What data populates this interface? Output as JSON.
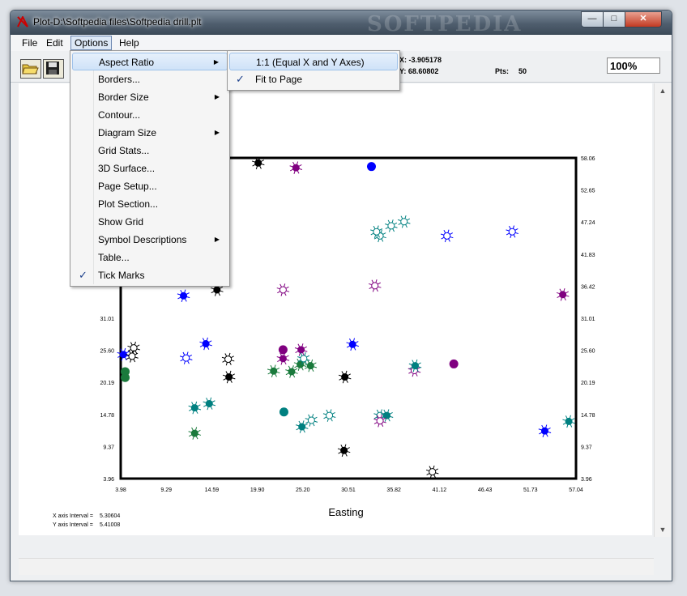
{
  "window": {
    "title": "Plot-D:\\Softpedia files\\Softpedia drill.plt",
    "watermark": "SOFTPEDIA"
  },
  "caption_buttons": {
    "minimize": "—",
    "maximize": "□",
    "close": "✕"
  },
  "menubar": {
    "file": "File",
    "edit": "Edit",
    "options": "Options",
    "help": "Help"
  },
  "toolbar": {
    "x_readout": "X: -3.905178",
    "y_readout": "Y: 68.60802",
    "pts_label": "Pts:",
    "pts_value": "50",
    "zoom": "100%"
  },
  "options_menu": [
    {
      "label": "Aspect Ratio",
      "submenu": true,
      "checked": false
    },
    {
      "label": "Borders...",
      "submenu": false,
      "checked": false
    },
    {
      "label": "Border Size",
      "submenu": true,
      "checked": false
    },
    {
      "label": "Contour...",
      "submenu": false,
      "checked": false
    },
    {
      "label": "Diagram Size",
      "submenu": true,
      "checked": false
    },
    {
      "label": "Grid Stats...",
      "submenu": false,
      "checked": false
    },
    {
      "label": "3D Surface...",
      "submenu": false,
      "checked": false
    },
    {
      "label": "Page Setup...",
      "submenu": false,
      "checked": false
    },
    {
      "label": "Plot Section...",
      "submenu": false,
      "checked": false
    },
    {
      "label": "Show Grid",
      "submenu": false,
      "checked": false
    },
    {
      "label": "Symbol Descriptions",
      "submenu": true,
      "checked": false
    },
    {
      "label": "Table...",
      "submenu": false,
      "checked": false
    },
    {
      "label": "Tick Marks",
      "submenu": false,
      "checked": true
    }
  ],
  "aspect_submenu": [
    {
      "label": "1:1 (Equal X and Y Axes)",
      "checked": false,
      "highlighted": true
    },
    {
      "label": "Fit to Page",
      "checked": true,
      "highlighted": false
    }
  ],
  "icons": {
    "open": "open-folder-icon",
    "save": "floppy-disk-icon",
    "app": "plot-d-app-icon",
    "check": "checkmark-icon",
    "submenu": "submenu-arrow-icon"
  },
  "colors": {
    "blue": "#0000ff",
    "purple": "#800080",
    "teal": "#008080",
    "green": "#1a7a3c",
    "black": "#000000",
    "hollow": "#ffffff"
  },
  "chart_data": {
    "type": "scatter",
    "xlabel": "Easting",
    "ylabel": "",
    "x_ticks": [
      "3.98",
      "9.29",
      "14.59",
      "19.90",
      "25.20",
      "30.51",
      "35.82",
      "41.12",
      "46.43",
      "51.73",
      "57.04"
    ],
    "y_ticks": [
      "3.96",
      "9.37",
      "14.78",
      "20.19",
      "25.60",
      "31.01",
      "36.42",
      "41.83",
      "47.24",
      "52.65",
      "58.06"
    ],
    "xlim": [
      3.98,
      57.04
    ],
    "ylim": [
      3.96,
      58.06
    ],
    "x_interval_label": "X axis Interval =",
    "x_interval": "5.30604",
    "y_interval_label": "Y axis Interval =",
    "y_interval": "5.41008",
    "grid": false,
    "points": [
      {
        "x": 20.0,
        "y": 57.2,
        "color": "black",
        "style": "burst"
      },
      {
        "x": 24.4,
        "y": 56.4,
        "color": "purple",
        "style": "burst"
      },
      {
        "x": 33.2,
        "y": 56.6,
        "color": "blue",
        "style": "dot"
      },
      {
        "x": 35.5,
        "y": 46.6,
        "color": "teal",
        "style": "open"
      },
      {
        "x": 34.2,
        "y": 44.9,
        "color": "teal",
        "style": "open"
      },
      {
        "x": 42.0,
        "y": 44.9,
        "color": "blue",
        "style": "open"
      },
      {
        "x": 49.6,
        "y": 45.6,
        "color": "blue",
        "style": "open"
      },
      {
        "x": 22.9,
        "y": 35.8,
        "color": "purple",
        "style": "open"
      },
      {
        "x": 33.6,
        "y": 36.5,
        "color": "purple",
        "style": "open"
      },
      {
        "x": 55.5,
        "y": 35.0,
        "color": "purple",
        "style": "burst"
      },
      {
        "x": 11.3,
        "y": 34.8,
        "color": "blue",
        "style": "burst"
      },
      {
        "x": 15.2,
        "y": 35.8,
        "color": "black",
        "style": "burst"
      },
      {
        "x": 4.3,
        "y": 24.9,
        "color": "blue",
        "style": "burst"
      },
      {
        "x": 5.5,
        "y": 26.0,
        "color": "hollow",
        "style": "open"
      },
      {
        "x": 5.3,
        "y": 24.6,
        "color": "hollow",
        "style": "open"
      },
      {
        "x": 4.5,
        "y": 22.0,
        "color": "green",
        "style": "dot"
      },
      {
        "x": 4.5,
        "y": 21.0,
        "color": "green",
        "style": "dot"
      },
      {
        "x": 11.6,
        "y": 24.3,
        "color": "blue",
        "style": "open"
      },
      {
        "x": 13.9,
        "y": 26.7,
        "color": "blue",
        "style": "burst"
      },
      {
        "x": 16.5,
        "y": 24.1,
        "color": "hollow",
        "style": "open"
      },
      {
        "x": 16.6,
        "y": 21.1,
        "color": "black",
        "style": "burst"
      },
      {
        "x": 22.9,
        "y": 25.7,
        "color": "purple",
        "style": "dot"
      },
      {
        "x": 25.0,
        "y": 25.7,
        "color": "purple",
        "style": "burst"
      },
      {
        "x": 22.9,
        "y": 24.2,
        "color": "purple",
        "style": "burst"
      },
      {
        "x": 31.0,
        "y": 26.6,
        "color": "blue",
        "style": "burst"
      },
      {
        "x": 21.8,
        "y": 22.1,
        "color": "green",
        "style": "burst"
      },
      {
        "x": 23.9,
        "y": 22.0,
        "color": "green",
        "style": "burst"
      },
      {
        "x": 24.9,
        "y": 23.2,
        "color": "green",
        "style": "burst"
      },
      {
        "x": 26.1,
        "y": 23.0,
        "color": "green",
        "style": "burst"
      },
      {
        "x": 25.3,
        "y": 24.2,
        "color": "teal",
        "style": "open"
      },
      {
        "x": 30.1,
        "y": 21.1,
        "color": "black",
        "style": "burst"
      },
      {
        "x": 38.2,
        "y": 22.2,
        "color": "purple",
        "style": "open"
      },
      {
        "x": 38.3,
        "y": 23.0,
        "color": "teal",
        "style": "burst"
      },
      {
        "x": 42.8,
        "y": 23.3,
        "color": "purple",
        "style": "dot"
      },
      {
        "x": 12.6,
        "y": 15.9,
        "color": "teal",
        "style": "burst"
      },
      {
        "x": 14.3,
        "y": 16.6,
        "color": "teal",
        "style": "burst"
      },
      {
        "x": 23.0,
        "y": 15.2,
        "color": "teal",
        "style": "dot"
      },
      {
        "x": 26.2,
        "y": 13.8,
        "color": "teal",
        "style": "open"
      },
      {
        "x": 28.3,
        "y": 14.6,
        "color": "teal",
        "style": "open"
      },
      {
        "x": 25.1,
        "y": 12.7,
        "color": "teal",
        "style": "burst"
      },
      {
        "x": 12.6,
        "y": 11.6,
        "color": "green",
        "style": "burst"
      },
      {
        "x": 30.0,
        "y": 8.7,
        "color": "black",
        "style": "burst"
      },
      {
        "x": 34.2,
        "y": 14.6,
        "color": "teal",
        "style": "open"
      },
      {
        "x": 35.0,
        "y": 14.6,
        "color": "teal",
        "style": "burst"
      },
      {
        "x": 34.2,
        "y": 13.7,
        "color": "purple",
        "style": "open"
      },
      {
        "x": 40.3,
        "y": 5.1,
        "color": "hollow",
        "style": "open"
      },
      {
        "x": 53.4,
        "y": 12.0,
        "color": "blue",
        "style": "burst"
      },
      {
        "x": 56.2,
        "y": 13.6,
        "color": "teal",
        "style": "burst"
      },
      {
        "x": 37.0,
        "y": 47.3,
        "color": "teal",
        "style": "open"
      },
      {
        "x": 33.8,
        "y": 45.6,
        "color": "teal",
        "style": "open"
      }
    ]
  }
}
